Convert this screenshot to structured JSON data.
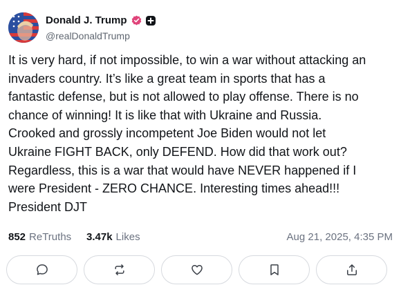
{
  "author": {
    "display_name": "Donald J. Trump",
    "handle": "@realDonaldTrump",
    "verified_icon": "verified-badge-icon",
    "plus_icon": "plus-badge-icon",
    "badge_color": "#e0447a"
  },
  "post": {
    "text": "It is very hard, if not impossible, to win a war without attacking an\ninvaders country. It’s like a great team in sports that has a\nfantastic defense, but is not allowed to play offense. There is no\nchance of winning! It is like that with Ukraine and Russia.\nCrooked and grossly incompetent Joe Biden would not let\nUkraine FIGHT BACK, only DEFEND. How did that work out?\nRegardless, this is a war that would have NEVER happened if I\nwere President - ZERO CHANCE. Interesting times ahead!!!\nPresident DJT"
  },
  "stats": {
    "retruths_count": "852",
    "retruths_label": "ReTruths",
    "likes_count": "3.47k",
    "likes_label": "Likes",
    "timestamp": "Aug 21, 2025, 4:35 PM"
  },
  "actions": [
    {
      "name": "reply-button",
      "icon": "comment-icon"
    },
    {
      "name": "retruth-button",
      "icon": "repost-icon"
    },
    {
      "name": "like-button",
      "icon": "heart-icon"
    },
    {
      "name": "bookmark-button",
      "icon": "bookmark-icon"
    },
    {
      "name": "share-button",
      "icon": "share-icon"
    }
  ]
}
